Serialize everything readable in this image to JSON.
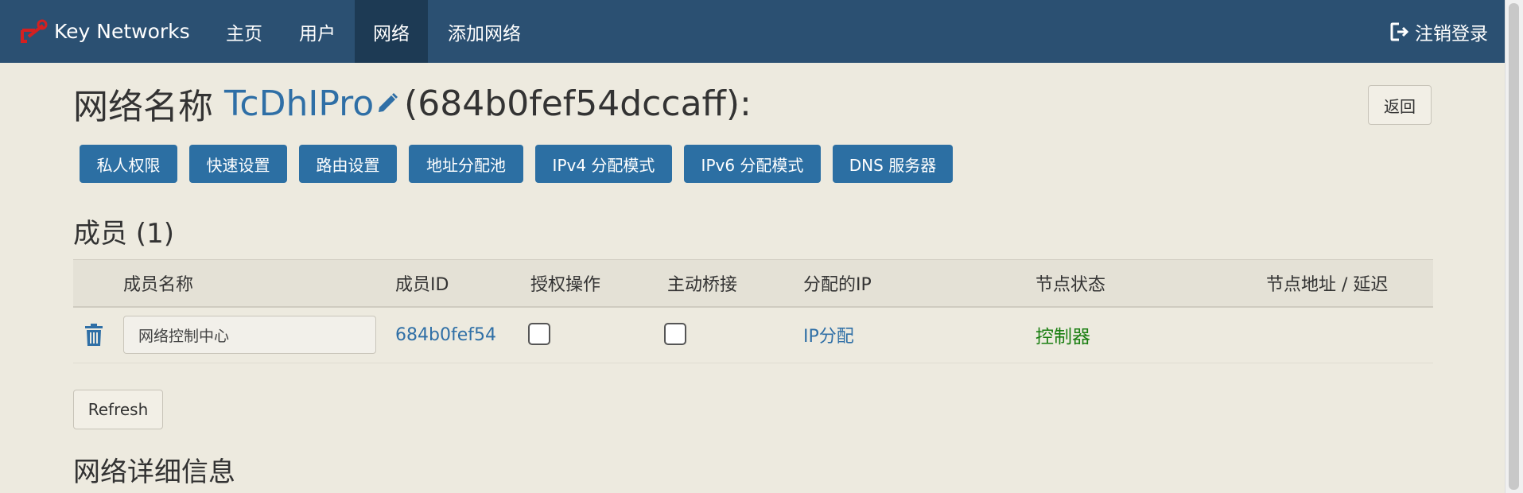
{
  "nav": {
    "brand": "Key Networks",
    "items": [
      {
        "label": "主页"
      },
      {
        "label": "用户"
      },
      {
        "label": "网络"
      },
      {
        "label": "添加网络"
      }
    ],
    "logout": "注销登录"
  },
  "header": {
    "prefix": "网络名称",
    "network_name": "TcDhIPro",
    "network_id": "(684b0fef54dccaff):",
    "back": "返回"
  },
  "actions": [
    "私人权限",
    "快速设置",
    "路由设置",
    "地址分配池",
    "IPv4 分配模式",
    "IPv6 分配模式",
    "DNS 服务器"
  ],
  "members": {
    "title": "成员 (1)",
    "columns": [
      "成员名称",
      "成员ID",
      "授权操作",
      "主动桥接",
      "分配的IP",
      "节点状态",
      "节点地址 / 延迟"
    ],
    "rows": [
      {
        "name": "网络控制中心",
        "id": "684b0fef54",
        "authorized": false,
        "bridge": false,
        "ip": "IP分配",
        "status": "控制器",
        "address": ""
      }
    ],
    "refresh": "Refresh"
  },
  "details_title": "网络详细信息",
  "colors": {
    "navbar": "#2b5072",
    "accent": "#2c6fa3",
    "link": "#2f6fa6",
    "status_green": "#1b7f12",
    "background": "#edeadf"
  }
}
